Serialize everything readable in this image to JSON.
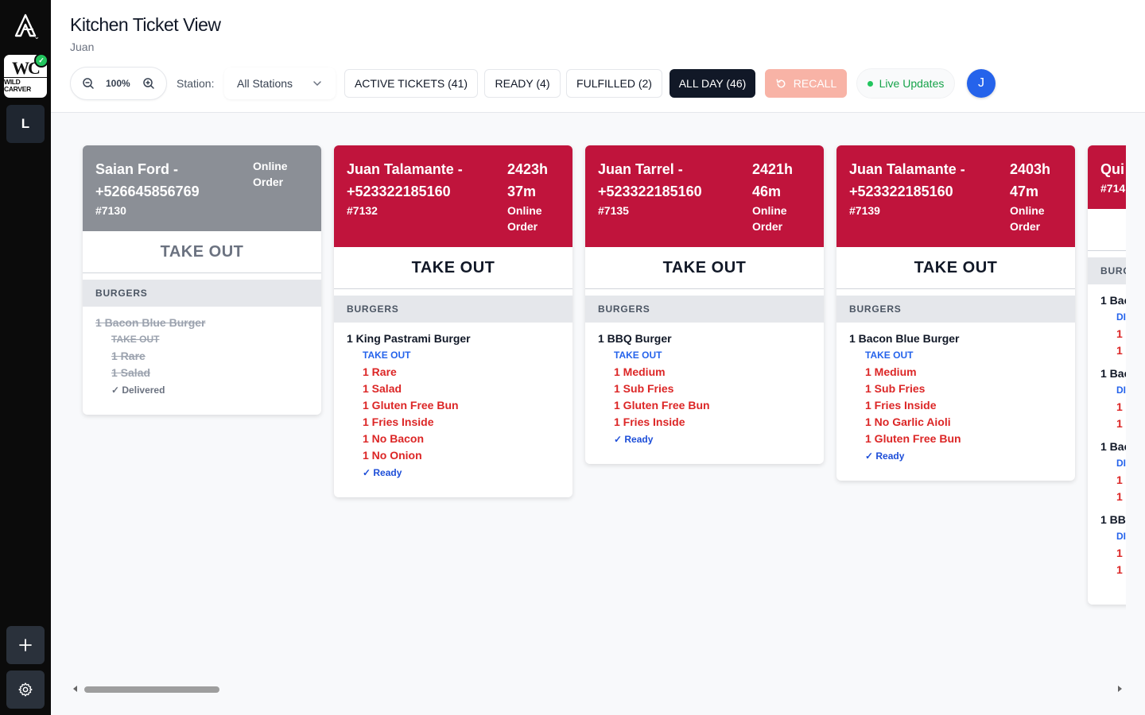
{
  "app": {
    "title": "Kitchen Ticket View",
    "user_name": "Juan",
    "workspace_initial": "L",
    "avatar_initial": "J",
    "brand_logo_text": "WILD CARVER"
  },
  "toolbar": {
    "zoom_value": "100%",
    "station_label": "Station:",
    "station_value": "All Stations",
    "filters": {
      "active": "ACTIVE TICKETS (41)",
      "ready": "READY (4)",
      "fulfilled": "FULFILLED (2)",
      "all_day": "ALL DAY (46)"
    },
    "recall_label": "RECALL",
    "live_label": "Live Updates"
  },
  "colors": {
    "ticket_red": "#c0143c",
    "ticket_gray": "#8b8f96",
    "modifier_red": "#dc2626",
    "status_blue": "#1d4ed8",
    "all_day_active": "#111827",
    "recall": "#f8b3a6",
    "live_green": "#16a34a",
    "avatar_blue": "#2563eb"
  },
  "tickets": [
    {
      "customer": "Saian Ford - +526645856769",
      "number": "#7130",
      "elapsed": "",
      "channel": "Online Order",
      "order_type": "TAKE OUT",
      "category": "BURGERS",
      "state": "delivered",
      "items": [
        {
          "name": "1 Bacon Blue Burger",
          "mods": [
            "TAKE OUT",
            "1 Rare",
            "1 Salad"
          ],
          "status": "✓ Delivered"
        }
      ]
    },
    {
      "customer": "Juan Talamante - +523322185160",
      "number": "#7132",
      "elapsed": "2423h 37m",
      "channel": "Online Order",
      "order_type": "TAKE OUT",
      "category": "BURGERS",
      "state": "ready",
      "items": [
        {
          "name": "1 King Pastrami Burger",
          "mods": [
            "TAKE OUT",
            "1 Rare",
            "1 Salad",
            "1 Gluten Free Bun",
            "1 Fries Inside",
            "1 No Bacon",
            "1 No Onion"
          ],
          "status": "✓ Ready"
        }
      ]
    },
    {
      "customer": "Juan Tarrel - +523322185160",
      "number": "#7135",
      "elapsed": "2421h 46m",
      "channel": "Online Order",
      "order_type": "TAKE OUT",
      "category": "BURGERS",
      "state": "ready",
      "items": [
        {
          "name": "1 BBQ Burger",
          "mods": [
            "TAKE OUT",
            "1 Medium",
            "1 Sub Fries",
            "1 Gluten Free Bun",
            "1 Fries Inside"
          ],
          "status": "✓ Ready"
        }
      ]
    },
    {
      "customer": "Juan Talamante - +523322185160",
      "number": "#7139",
      "elapsed": "2403h 47m",
      "channel": "Online Order",
      "order_type": "TAKE OUT",
      "category": "BURGERS",
      "state": "ready",
      "items": [
        {
          "name": "1 Bacon Blue Burger",
          "mods": [
            "TAKE OUT",
            "1 Medium",
            "1 Sub Fries",
            "1 Fries Inside",
            "1 No Garlic Aioli",
            "1 Gluten Free Bun"
          ],
          "status": "✓ Ready"
        }
      ]
    },
    {
      "customer": "Qui",
      "number": "#714",
      "order_type": "",
      "category": "BURG",
      "state": "partial",
      "items": [
        {
          "name": "1 Bac",
          "mods": [
            "DI",
            "1",
            "1"
          ]
        },
        {
          "name": "1 Bac",
          "mods": [
            "DI",
            "1",
            "1"
          ]
        },
        {
          "name": "1 Bac",
          "mods": [
            "DI",
            "1",
            "1"
          ]
        },
        {
          "name": "1 BB",
          "mods": [
            "DI",
            "1",
            "1"
          ]
        }
      ]
    }
  ]
}
